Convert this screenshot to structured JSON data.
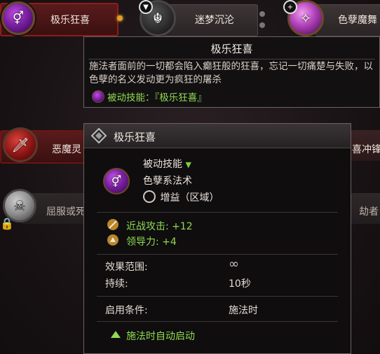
{
  "background": {
    "skills": [
      {
        "label": "极乐狂喜"
      },
      {
        "label": "迷梦沉沦"
      },
      {
        "label": "色孽魔舞"
      },
      {
        "label": "恶魔灵"
      },
      {
        "label": "喜冲锋"
      },
      {
        "label": "屈服或死"
      },
      {
        "label": "劫者"
      }
    ]
  },
  "tooltip_summary": {
    "title": "极乐狂喜",
    "description": "施法者面前的一切都会陷入癫狂般的狂喜，忘记一切痛楚与失败，以色孽的名义发动更为疯狂的屠杀",
    "passive_line": "被动技能：『极乐狂喜』"
  },
  "tooltip_detail": {
    "title": "极乐狂喜",
    "type": "被动技能",
    "lore": "色孽系法术",
    "effect": "增益（区域）",
    "stats": [
      {
        "label": "近战攻击: +12"
      },
      {
        "label": "领导力: +4"
      }
    ],
    "rows": [
      {
        "key": "效果范围:",
        "value": "∞"
      },
      {
        "key": "持续:",
        "value": "10秒"
      },
      {
        "key": "启用条件:",
        "value": "施法时"
      }
    ],
    "auto_cast": "施法时自动启动"
  },
  "colors": {
    "accent_green": "#8fdc52",
    "border": "#6e6262",
    "highlight_red": "#8c1d1d",
    "slaanesh_purple": "#7b1fa2"
  }
}
